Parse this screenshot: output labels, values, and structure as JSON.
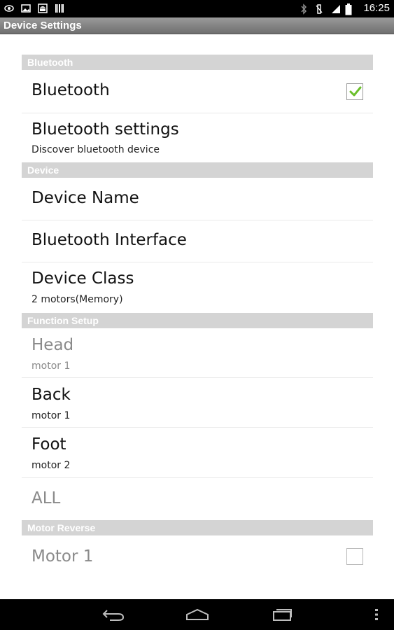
{
  "status_bar": {
    "time": "16:25",
    "left_icons": [
      "eye-icon",
      "image-icon",
      "android-icon",
      "barcode-icon"
    ],
    "right_icons": [
      "bluetooth-icon",
      "vibrate-icon",
      "signal-icon",
      "battery-icon"
    ]
  },
  "title_bar": {
    "title": "Device Settings"
  },
  "sections": {
    "bluetooth": {
      "header": "Bluetooth",
      "bluetooth_toggle": {
        "title": "Bluetooth",
        "checked": true
      },
      "bluetooth_settings": {
        "title": "Bluetooth settings",
        "summary": "Discover bluetooth device"
      }
    },
    "device": {
      "header": "Device",
      "device_name": {
        "title": "Device Name"
      },
      "bluetooth_interface": {
        "title": "Bluetooth Interface"
      },
      "device_class": {
        "title": "Device Class",
        "summary": "2 motors(Memory)"
      }
    },
    "function_setup": {
      "header": "Function Setup",
      "head": {
        "title": "Head",
        "summary": "motor 1",
        "enabled": false
      },
      "back": {
        "title": "Back",
        "summary": "motor 1",
        "enabled": true
      },
      "foot": {
        "title": "Foot",
        "summary": "motor 2",
        "enabled": true
      },
      "all": {
        "title": "ALL",
        "enabled": false
      }
    },
    "motor_reverse": {
      "header": "Motor Reverse",
      "motor1": {
        "title": "Motor 1",
        "checked": false,
        "enabled": false
      }
    }
  },
  "nav_bar": {
    "buttons": [
      "back-icon",
      "home-icon",
      "recent-apps-icon",
      "menu-icon"
    ]
  },
  "colors": {
    "check": "#6abf2a",
    "section_header": "#d4d4d4",
    "title_bar": "#7f7f7f"
  }
}
